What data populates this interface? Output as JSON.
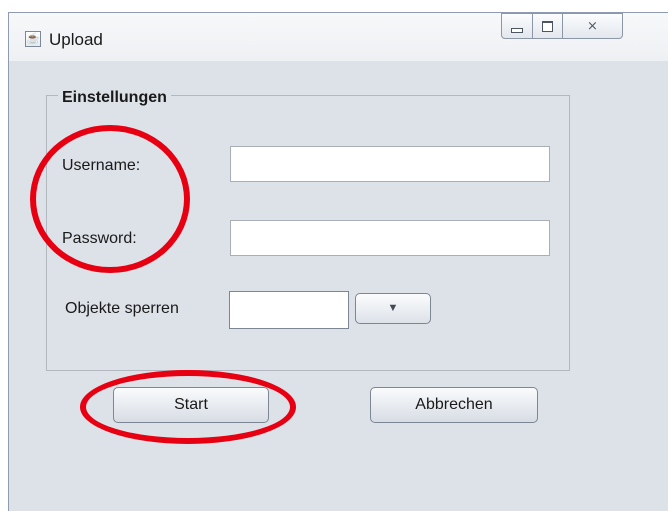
{
  "window": {
    "title": "Upload",
    "app_icon": "java-icon",
    "controls": [
      "minimize-icon",
      "maximize-icon",
      "close-icon"
    ],
    "close_glyph": "⨯"
  },
  "settings": {
    "group_title": "Einstellungen",
    "username_label": "Username:",
    "username_value": "",
    "password_label": "Password:",
    "password_value": "",
    "lock_objects_label": "Objekte sperren",
    "lock_objects_value": "",
    "dropdown_glyph": "▼"
  },
  "actions": {
    "start_label": "Start",
    "cancel_label": "Abbrechen"
  },
  "annotations": {
    "highlight_color": "#e60012"
  }
}
